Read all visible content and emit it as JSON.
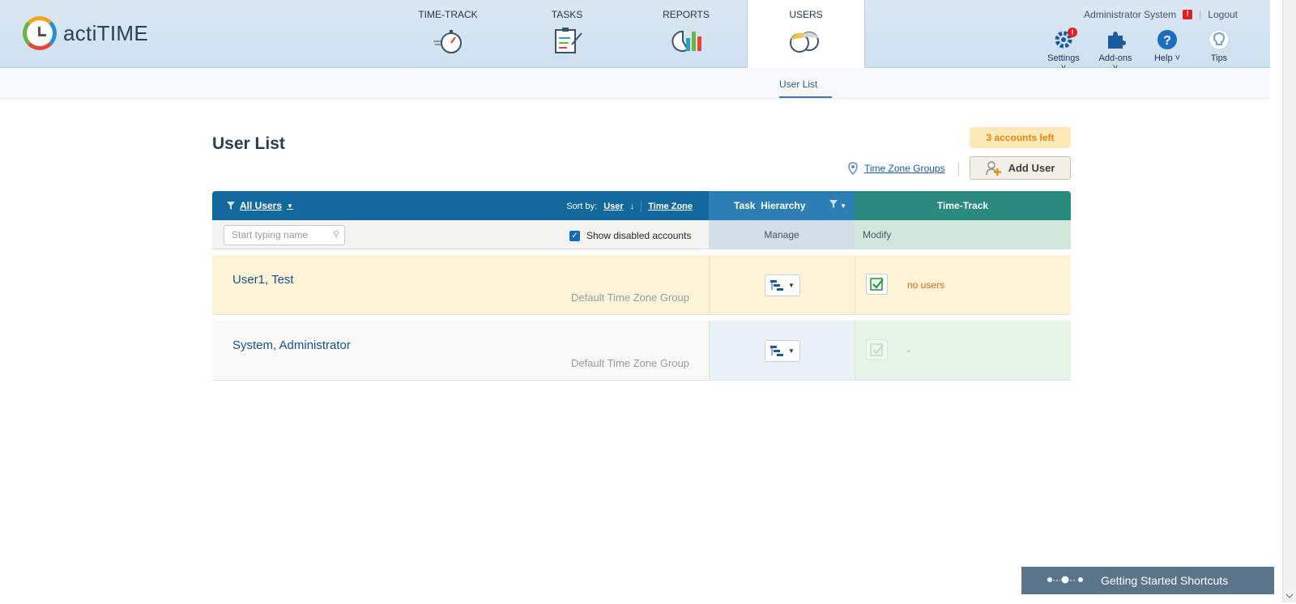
{
  "app": {
    "logo_text": "actiTIME"
  },
  "nav": {
    "items": [
      {
        "label": "TIME-TRACK"
      },
      {
        "label": "TASKS"
      },
      {
        "label": "REPORTS"
      },
      {
        "label": "USERS",
        "active": true
      }
    ]
  },
  "header_right": {
    "user_name": "Administrator System",
    "alert_badge": "!",
    "logout_label": "Logout",
    "tools": [
      {
        "label": "Settings",
        "icon": "gear-icon",
        "badge": "!"
      },
      {
        "label": "Add-ons",
        "icon": "puzzle-icon"
      },
      {
        "label": "Help",
        "icon": "question-icon"
      },
      {
        "label": "Tips",
        "icon": "lightbulb-icon"
      }
    ]
  },
  "subnav": {
    "tab_label": "User List"
  },
  "page": {
    "title": "User List",
    "accounts_left": "3 accounts left",
    "time_zone_groups_link": "Time Zone Groups",
    "add_user_label": "Add User"
  },
  "table": {
    "filter_label": "All Users",
    "sort_by_label": "Sort by:",
    "sort_user_label": "User",
    "sort_timezone_label": "Time Zone",
    "task_hierarchy_label": "Task  Hierarchy",
    "time_track_label": "Time-Track",
    "search_placeholder": "Start typing name",
    "show_disabled_label": "Show disabled accounts",
    "show_disabled_checked": true,
    "manage_label": "Manage",
    "modify_label": "Modify",
    "rows": [
      {
        "name": "User1, Test",
        "tz_group": "Default Time Zone Group",
        "time_track": "no users"
      },
      {
        "name": "System, Administrator",
        "tz_group": "Default Time Zone Group",
        "time_track": "-"
      }
    ]
  },
  "footer": {
    "getting_started_label": "Getting Started Shortcuts"
  },
  "colors": {
    "header_blue": "#13699e",
    "task_blue": "#2d7fb3",
    "time_track_green": "#2a8a7e",
    "highlight_row": "#fdf4d7",
    "accounts_badge": "#fde9b7",
    "warning_orange": "#e0661c"
  }
}
